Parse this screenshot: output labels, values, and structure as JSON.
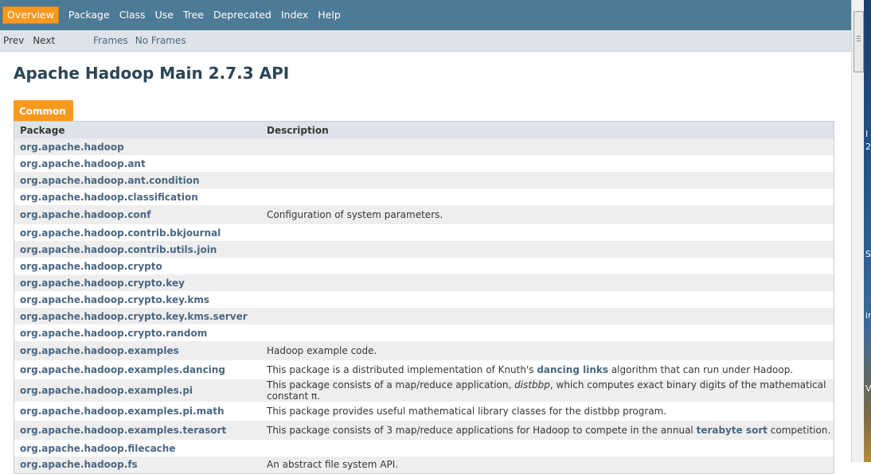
{
  "topnav": {
    "tabs": [
      {
        "label": "Overview",
        "active": true
      },
      {
        "label": "Package",
        "active": false
      },
      {
        "label": "Class",
        "active": false
      },
      {
        "label": "Use",
        "active": false
      },
      {
        "label": "Tree",
        "active": false
      },
      {
        "label": "Deprecated",
        "active": false
      },
      {
        "label": "Index",
        "active": false
      },
      {
        "label": "Help",
        "active": false
      }
    ]
  },
  "subnav": {
    "prev": "Prev",
    "next": "Next",
    "frames": "Frames",
    "no_frames": "No Frames"
  },
  "page_title": "Apache Hadoop Main 2.7.3 API",
  "table": {
    "caption": "Common",
    "headers": {
      "package": "Package",
      "description": "Description"
    },
    "rows": [
      {
        "package": "org.apache.hadoop",
        "description": ""
      },
      {
        "package": "org.apache.hadoop.ant",
        "description": ""
      },
      {
        "package": "org.apache.hadoop.ant.condition",
        "description": ""
      },
      {
        "package": "org.apache.hadoop.classification",
        "description": ""
      },
      {
        "package": "org.apache.hadoop.conf",
        "description": "Configuration of system parameters."
      },
      {
        "package": "org.apache.hadoop.contrib.bkjournal",
        "description": ""
      },
      {
        "package": "org.apache.hadoop.contrib.utils.join",
        "description": ""
      },
      {
        "package": "org.apache.hadoop.crypto",
        "description": ""
      },
      {
        "package": "org.apache.hadoop.crypto.key",
        "description": ""
      },
      {
        "package": "org.apache.hadoop.crypto.key.kms",
        "description": ""
      },
      {
        "package": "org.apache.hadoop.crypto.key.kms.server",
        "description": ""
      },
      {
        "package": "org.apache.hadoop.crypto.random",
        "description": ""
      },
      {
        "package": "org.apache.hadoop.examples",
        "description": "Hadoop example code."
      },
      {
        "package": "org.apache.hadoop.examples.dancing",
        "desc_parts": [
          "This package is a distributed implementation of Knuth's ",
          "dancing links",
          " algorithm that can run under Hadoop."
        ]
      },
      {
        "package": "org.apache.hadoop.examples.pi",
        "desc_parts": [
          "This package consists of a map/reduce application, ",
          "distbbp",
          ", which computes exact binary digits of the mathematical constant π."
        ]
      },
      {
        "package": "org.apache.hadoop.examples.pi.math",
        "description": "This package provides useful mathematical library classes for the distbbp program."
      },
      {
        "package": "org.apache.hadoop.examples.terasort",
        "desc_parts": [
          "This package consists of 3 map/reduce applications for Hadoop to compete in the annual ",
          "terabyte sort",
          " competition."
        ]
      },
      {
        "package": "org.apache.hadoop.filecache",
        "description": ""
      },
      {
        "package": "org.apache.hadoop.fs",
        "description": "An abstract file system API."
      }
    ]
  },
  "desktop_strip": [
    "I",
    "2",
    "S",
    "ir",
    "V"
  ]
}
